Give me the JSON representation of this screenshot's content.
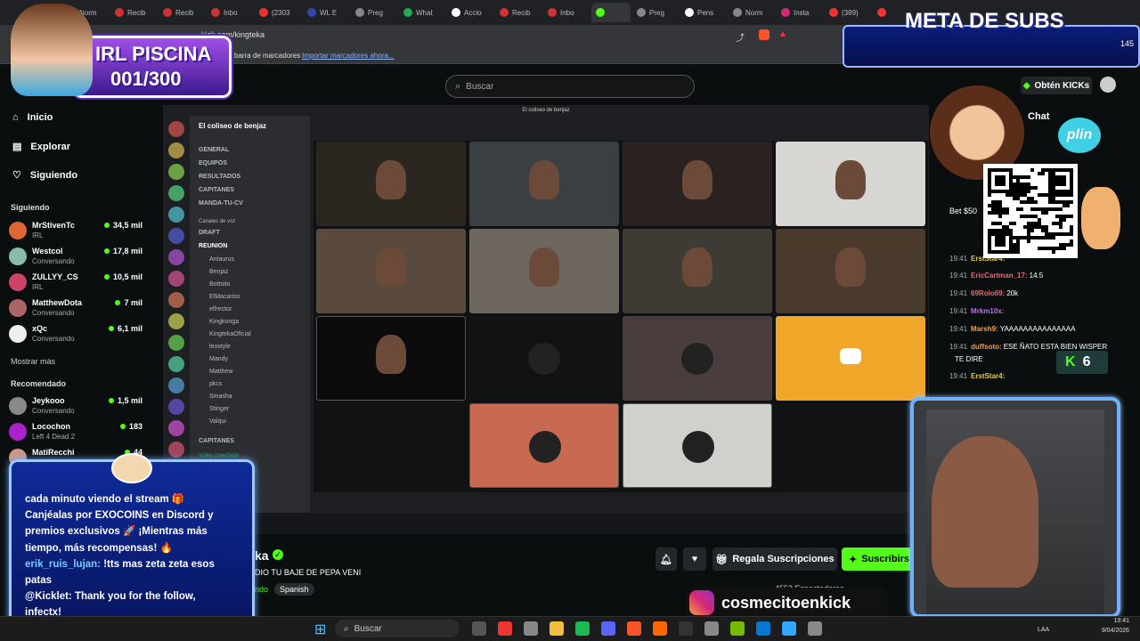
{
  "browser": {
    "tabs": [
      "Norm",
      "Recib",
      "Recib",
      "Inbo",
      "(2303",
      "WL E",
      "Preg",
      "What",
      "Accio",
      "Recib",
      "Inbo",
      "",
      "Preg",
      "Pens",
      "Norm",
      "Insta",
      "(389)",
      ""
    ],
    "url": "kick.com/kingteka",
    "bookmarks_text": "barra de marcadores",
    "bookmarks_link": "Importar marcadores ahora..."
  },
  "kick": {
    "search_placeholder": "Buscar",
    "nav": [
      {
        "label": "Inicio",
        "icon": "home-icon"
      },
      {
        "label": "Explorar",
        "icon": "compass-icon"
      },
      {
        "label": "Siguiendo",
        "icon": "heart-icon"
      }
    ],
    "following_title": "Siguiendo",
    "following": [
      {
        "name": "MrStivenTc",
        "sub": "IRL",
        "viewers": "34,5 mil",
        "color": "#d63"
      },
      {
        "name": "Westcol",
        "sub": "Conversando",
        "viewers": "17,8 mil",
        "color": "#8ba"
      },
      {
        "name": "ZULLYY_CS",
        "sub": "IRL",
        "viewers": "10,5 mil",
        "color": "#c46"
      },
      {
        "name": "MatthewDota",
        "sub": "Conversando",
        "viewers": "7 mil",
        "color": "#a66"
      },
      {
        "name": "xQc",
        "sub": "Conversando",
        "viewers": "6,1 mil",
        "color": "#eee"
      }
    ],
    "show_more": "Mostrar más",
    "recommended_title": "Recomendado",
    "recommended": [
      {
        "name": "Jeykooo",
        "sub": "Conversando",
        "viewers": "1,5 mil",
        "color": "#888"
      },
      {
        "name": "Locochon",
        "sub": "Left 4 Dead 2",
        "viewers": "183",
        "color": "#a2c"
      },
      {
        "name": "MatiRecchi",
        "sub": "",
        "viewers": "44",
        "color": "#c98"
      }
    ],
    "stream_title_fragment": "ka",
    "stream_sub_fragment": "DIO TU BAJE DE PEPA VENI",
    "category_fragment": "ndo",
    "language": "Spanish",
    "gift_button": "Regala Suscripciones",
    "subscribe_button": "Suscribirs",
    "viewers_text": "4553 Espectadores",
    "get_kicks": "Obtén KICKs",
    "chat_title": "Chat"
  },
  "discord": {
    "window_title": "El coliseo de benjaz",
    "server": "El coliseo de benjaz",
    "channels": [
      "GENERAL",
      "EQUIPOS",
      "RESULTADOS",
      "CAPITANES",
      "MANDA-TU-CV"
    ],
    "voice_header": "Canales de voz",
    "voice_channels": [
      "DRAFT",
      "REUNION"
    ],
    "users": [
      "Antaurus",
      "Benjaz",
      "Bottsito",
      "ElMacarios",
      "elfrector",
      "Kingkonga",
      "KingtekaOficial",
      "leostyle",
      "Mandy",
      "Matthew",
      "pkcs",
      "Smasha",
      "Stinger",
      "Valqui"
    ],
    "bottom_channel": "CAPITANES",
    "voice_status": "Vídeo conectado"
  },
  "chat": [
    {
      "time": "19:41",
      "user": "ErstStar4:",
      "text": "",
      "color": "#e8c94a"
    },
    {
      "time": "19:41",
      "user": "EricCartman_17:",
      "text": "14.5",
      "color": "#e06c75"
    },
    {
      "time": "19:41",
      "user": "69Rolo69:",
      "text": "20k",
      "color": "#e06c75"
    },
    {
      "time": "19:41",
      "user": "Mrkm10x:",
      "text": "",
      "color": "#b96ef0"
    },
    {
      "time": "19:41",
      "user": "Marsh9:",
      "text": "YAAAAAAAAAAAAAAA",
      "color": "#f0a04a"
    },
    {
      "time": "19:41",
      "user": "duffsoto:",
      "text": "ESE ÑATO ESTA BIEN WISPER",
      "color": "#f0a04a"
    },
    {
      "time": "",
      "user": "",
      "text": "TE DIRE",
      "color": "#fff"
    },
    {
      "time": "19:41",
      "user": "ErstStar4:",
      "text": "",
      "color": "#e8c94a"
    }
  ],
  "overlay": {
    "piscina_title": "IRL PISCINA",
    "piscina_count": "001/300",
    "meta_title": "META DE SUBS",
    "meta_value": "145",
    "plin": "plin",
    "bet_text": "Bet $50",
    "k_count": "6",
    "instagram": "cosmecitoenkick",
    "chatbox": [
      {
        "user": "",
        "text": "cada minuto viendo el stream 🎁",
        "color": "#fff"
      },
      {
        "user": "",
        "text": "Canjéalas por EXOCOINS en Discord y",
        "color": "#fff"
      },
      {
        "user": "",
        "text": "premios exclusivos 🚀 ¡Mientras más",
        "color": "#fff"
      },
      {
        "user": "",
        "text": "tiempo, más recompensas! 🔥",
        "color": "#fff"
      },
      {
        "user": "erik_ruis_lujan:",
        "text": " !tts mas zeta zeta esos",
        "color": "#7cf"
      },
      {
        "user": "",
        "text": "patas",
        "color": "#fff"
      },
      {
        "user": "@Kicklet:",
        "text": " Thank you for the follow,",
        "color": "#fff"
      },
      {
        "user": "",
        "text": "infectx!",
        "color": "#fff"
      }
    ]
  },
  "taskbar": {
    "search": "Buscar",
    "lang": "LAA",
    "time": "19:41",
    "date": "9/04/2026"
  }
}
